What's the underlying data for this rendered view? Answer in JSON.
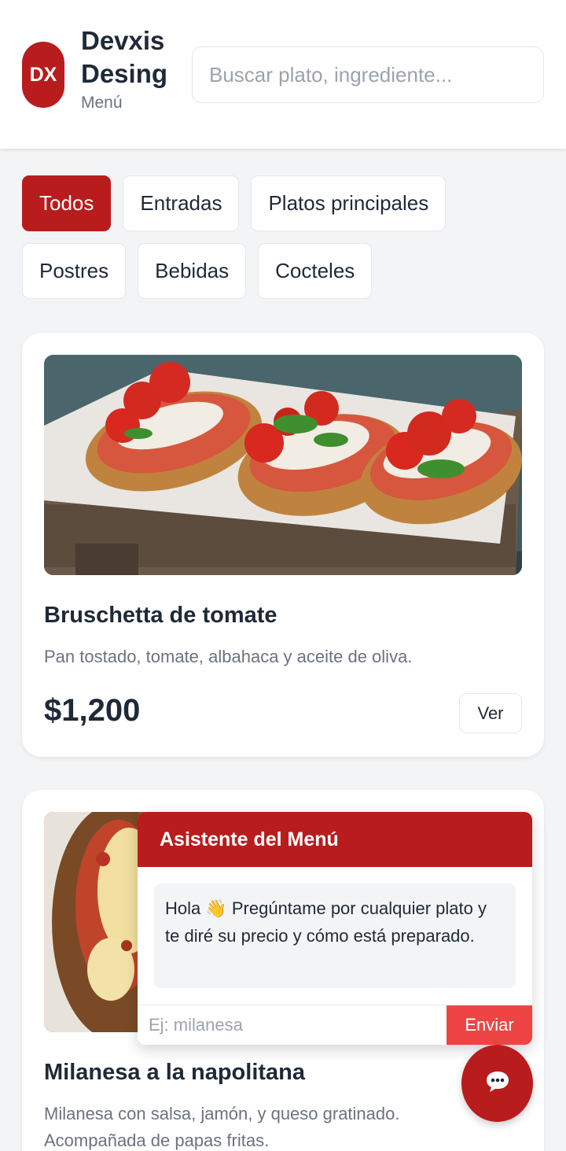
{
  "header": {
    "logo_text": "DX",
    "brand_name": "Devxis Desing",
    "brand_subtitle": "Menú",
    "search_placeholder": "Buscar plato, ingrediente..."
  },
  "categories": [
    {
      "label": "Todos",
      "active": true
    },
    {
      "label": "Entradas",
      "active": false
    },
    {
      "label": "Platos principales",
      "active": false
    },
    {
      "label": "Postres",
      "active": false
    },
    {
      "label": "Bebidas",
      "active": false
    },
    {
      "label": "Cocteles",
      "active": false
    }
  ],
  "dishes": [
    {
      "title": "Bruschetta de tomate",
      "description": "Pan tostado, tomate, albahaca y aceite de oliva.",
      "price": "$1,200",
      "view_label": "Ver"
    },
    {
      "title": "Milanesa a la napolitana",
      "description": "Milanesa con salsa, jamón, y queso gratinado. Acompañada de papas fritas."
    }
  ],
  "chat": {
    "title": "Asistente del Menú",
    "greeting": "Hola 👋 Pregúntame por cualquier plato y te diré su precio y cómo está preparado.",
    "input_placeholder": "Ej: milanesa",
    "send_label": "Enviar",
    "fab_icon": "chat-bubble-icon"
  },
  "colors": {
    "brand": "#b91c1c",
    "send": "#ef4444",
    "background": "#f3f4f6"
  }
}
